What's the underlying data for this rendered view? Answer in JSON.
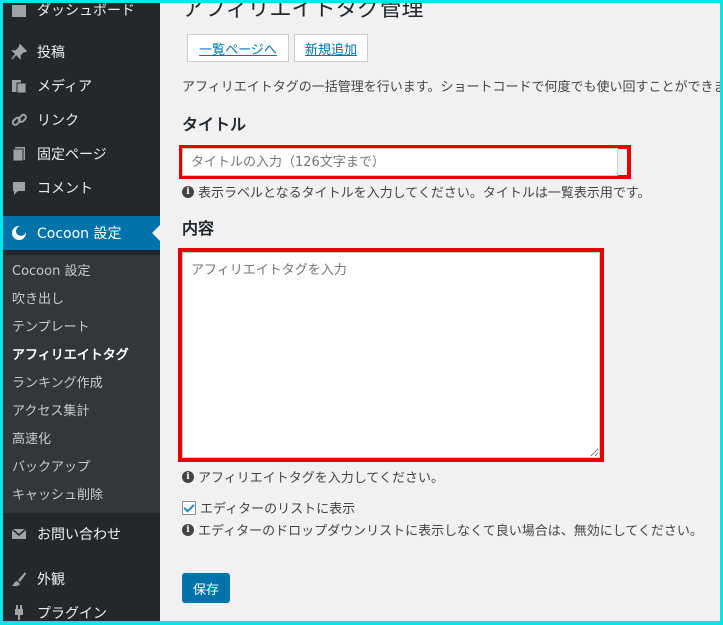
{
  "sidebar": {
    "top_partial": "ダッシュボード",
    "posts": "投稿",
    "media": "メディア",
    "links": "リンク",
    "pages": "固定ページ",
    "comments": "コメント",
    "cocoon": "Cocoon 設定",
    "submenu": [
      "Cocoon 設定",
      "吹き出し",
      "テンプレート",
      "アフィリエイトタグ",
      "ランキング作成",
      "アクセス集計",
      "高速化",
      "バックアップ",
      "キャッシュ削除"
    ],
    "contact": "お問い合わせ",
    "appearance": "外観",
    "plugins_partial": "プラグイン",
    "active_color": "#0073aa"
  },
  "main": {
    "title": "アフィリエイトタグ管理",
    "list_button": "一覧ページへ",
    "new_button": "新規追加",
    "description": "アフィリエイトタグの一括管理を行います。ショートコードで何度でも使い回すことができます。",
    "title_label": "タイトル",
    "title_placeholder": "タイトルの入力（126文字まで）",
    "title_hint": "表示ラベルとなるタイトルを入力してください。タイトルは一覧表示用です。",
    "content_label": "内容",
    "content_placeholder": "アフィリエイトタグを入力",
    "content_hint": "アフィリエイトタグを入力してください。",
    "editor_checkbox_label": "エディターのリストに表示",
    "editor_checkbox_checked": true,
    "editor_hint": "エディターのドロップダウンリストに表示しなくて良い場合は、無効にしてください。",
    "save_button": "保存",
    "highlight_color": "#e60000"
  }
}
